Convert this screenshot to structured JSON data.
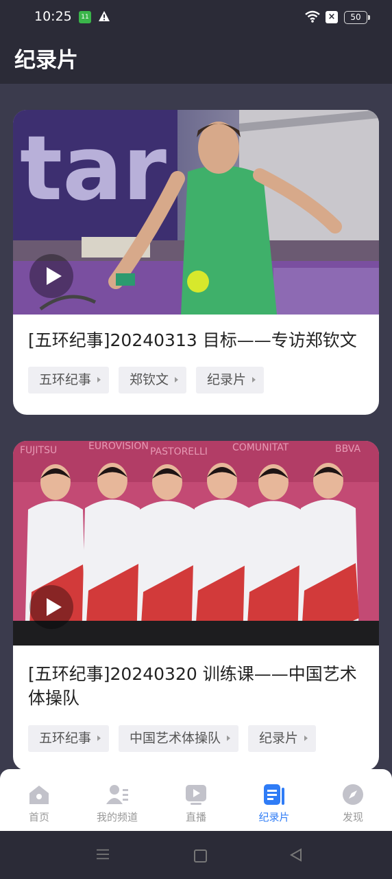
{
  "status": {
    "time": "10:25",
    "battery": "50",
    "sim_label": "11"
  },
  "header": {
    "title": "纪录片"
  },
  "cards": [
    {
      "title": "[五环纪事]20240313 目标——专访郑钦文",
      "tags": [
        "五环纪事",
        "郑钦文",
        "纪录片"
      ]
    },
    {
      "title": "[五环纪事]20240320 训练课——中国艺术体操队",
      "tags": [
        "五环纪事",
        "中国艺术体操队",
        "纪录片"
      ]
    }
  ],
  "tabbar": {
    "items": [
      {
        "label": "首页",
        "icon": "home-icon"
      },
      {
        "label": "我的频道",
        "icon": "channel-icon"
      },
      {
        "label": "直播",
        "icon": "live-icon"
      },
      {
        "label": "纪录片",
        "icon": "documentary-icon"
      },
      {
        "label": "发现",
        "icon": "compass-icon"
      }
    ],
    "active_index": 3
  },
  "colors": {
    "accent": "#2f7cf6",
    "header_bg": "#2b2b37",
    "page_bg": "#3b3b4d"
  }
}
